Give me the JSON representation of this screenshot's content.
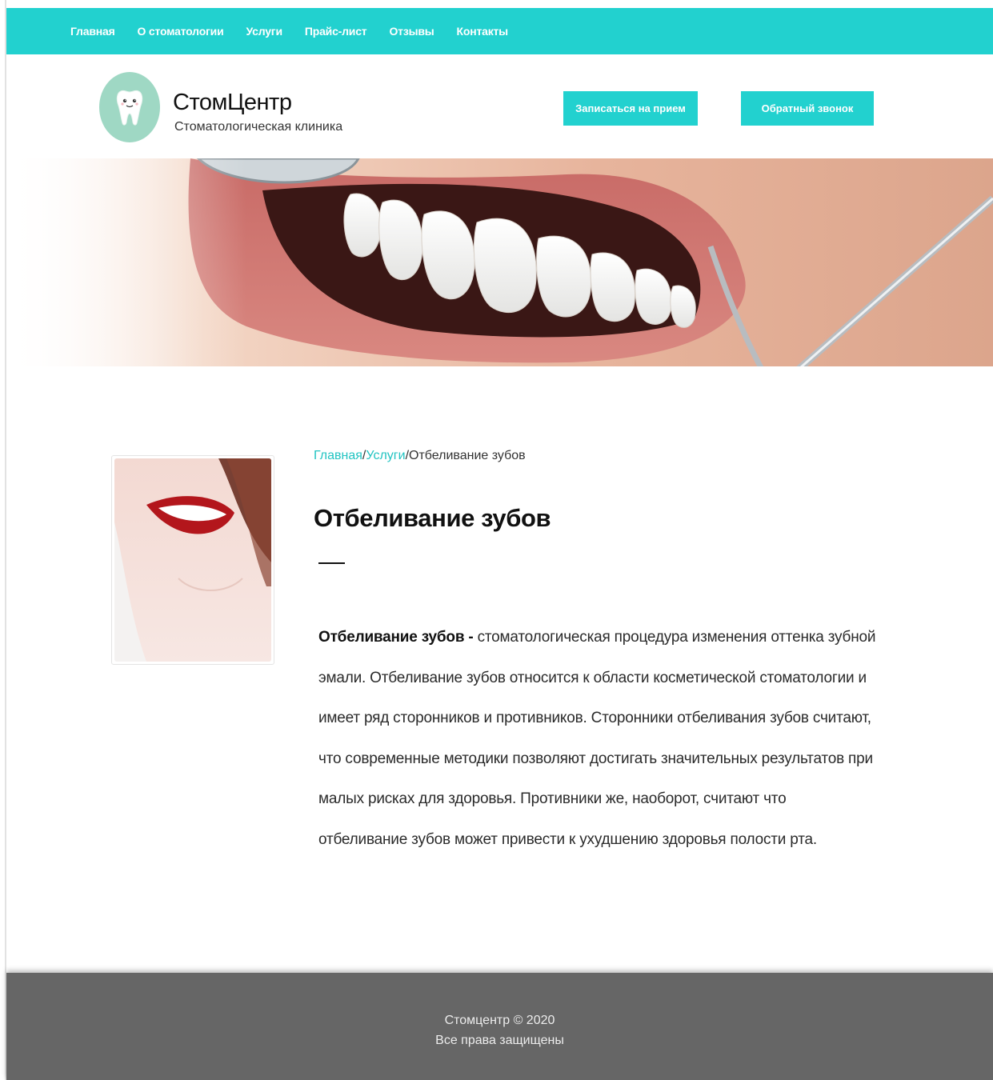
{
  "nav": {
    "items": [
      {
        "label": "Главная"
      },
      {
        "label": "О стоматологии"
      },
      {
        "label": "Услуги"
      },
      {
        "label": "Прайс-лист"
      },
      {
        "label": "Отзывы"
      },
      {
        "label": "Контакты"
      }
    ]
  },
  "header": {
    "brand_title": "СтомЦентр",
    "brand_subtitle": "Стоматологическая клиника",
    "appointment_button": "Записаться на прием",
    "callback_button": "Обратный звонок"
  },
  "breadcrumb": {
    "home": "Главная",
    "sep1": "/",
    "services": "Услуги",
    "sep2": "/",
    "current": "Отбеливание зубов"
  },
  "content": {
    "title": "Отбеливание зубов",
    "article_term": "Отбеливание зубов -",
    "article_text": " стоматологическая процедура изменения оттенка  зубной эмали. Отбеливание зубов относится к области косметической стоматологии и имеет ряд сторонников и противников. Сторонники отбеливания зубов считают, что современные методики позволяют достигать значительных результатов при малых рисках для здоровья. Противники же, наоборот, считают что отбеливание зубов может привести к ухудшению здоровья полости рта."
  },
  "footer": {
    "copyright": "Стомцентр © 2020",
    "rights": "Все права защищены"
  },
  "colors": {
    "accent": "#22d1cf",
    "footer_bg": "#666666",
    "logo_bg": "#9fd8c4"
  }
}
